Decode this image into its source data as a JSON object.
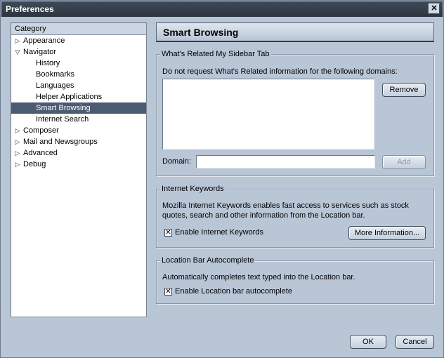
{
  "window": {
    "title": "Preferences",
    "close_glyph": "✕"
  },
  "tree": {
    "header": "Category",
    "items": [
      {
        "label": "Appearance",
        "level": 0,
        "twisty": "collapsed"
      },
      {
        "label": "Navigator",
        "level": 0,
        "twisty": "expanded"
      },
      {
        "label": "History",
        "level": 1
      },
      {
        "label": "Bookmarks",
        "level": 1
      },
      {
        "label": "Languages",
        "level": 1
      },
      {
        "label": "Helper Applications",
        "level": 1
      },
      {
        "label": "Smart Browsing",
        "level": 1,
        "selected": true
      },
      {
        "label": "Internet Search",
        "level": 1
      },
      {
        "label": "Composer",
        "level": 0,
        "twisty": "collapsed"
      },
      {
        "label": "Mail and Newsgroups",
        "level": 0,
        "twisty": "collapsed"
      },
      {
        "label": "Advanced",
        "level": 0,
        "twisty": "collapsed"
      },
      {
        "label": "Debug",
        "level": 0,
        "twisty": "collapsed"
      }
    ]
  },
  "panel": {
    "title": "Smart Browsing"
  },
  "related": {
    "legend": "What's Related My Sidebar Tab",
    "description": "Do not request What's Related information for the following domains:",
    "remove_label": "Remove",
    "domain_label": "Domain:",
    "domain_value": "",
    "add_label": "Add"
  },
  "keywords": {
    "legend": "Internet Keywords",
    "description_line1": "Mozilla Internet Keywords enables fast access to services such as stock",
    "description_line2": "quotes, search and other information from the Location bar.",
    "checkbox_label": "Enable Internet Keywords",
    "checked": true,
    "more_info_label": "More Information..."
  },
  "autocomplete": {
    "legend": "Location Bar Autocomplete",
    "description": "Automatically completes text typed into the Location bar.",
    "checkbox_label": "Enable Location bar autocomplete",
    "checked": true
  },
  "footer": {
    "ok_label": "OK",
    "cancel_label": "Cancel"
  },
  "colors": {
    "background": "#b9c6d6",
    "selection": "#4a5b72",
    "titlebar": "#2d3540"
  }
}
